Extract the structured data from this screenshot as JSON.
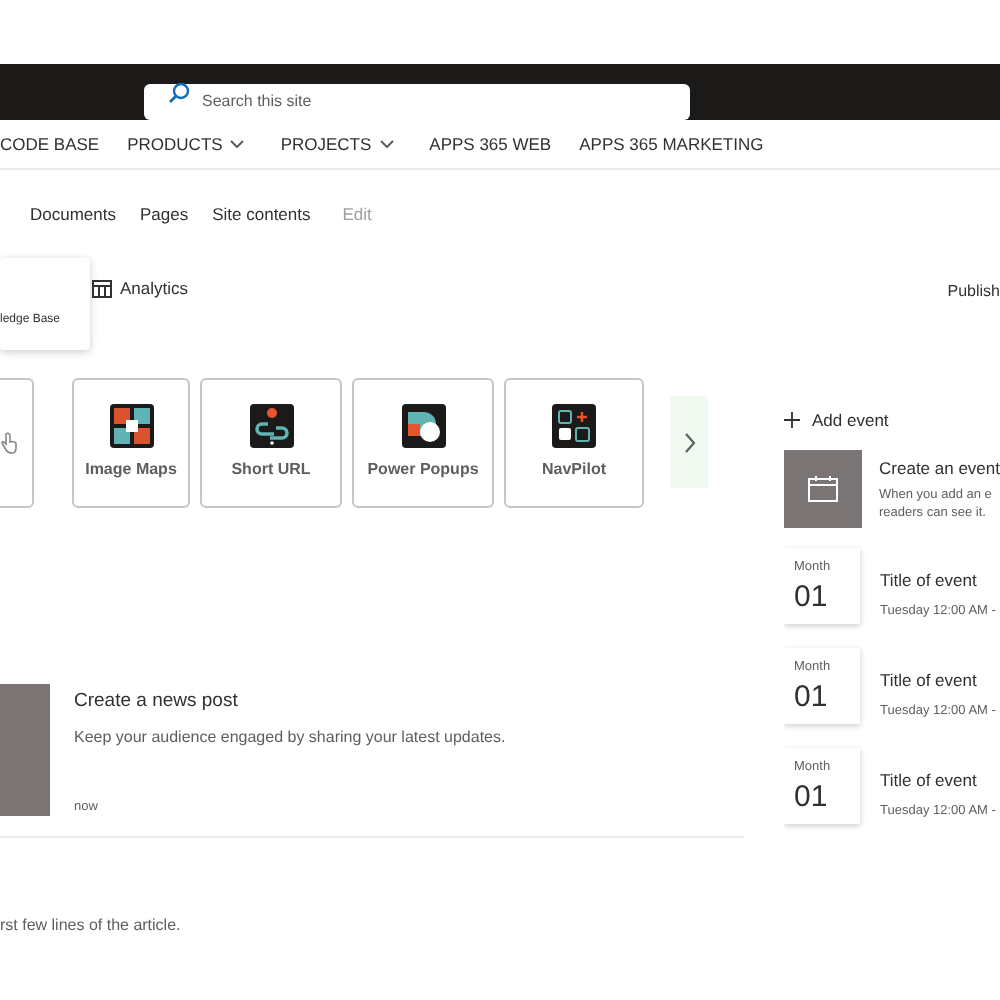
{
  "search": {
    "placeholder": "Search this site"
  },
  "nav": [
    {
      "label": "CODE BASE",
      "dropdown": false
    },
    {
      "label": "PRODUCTS",
      "dropdown": true
    },
    {
      "label": "PROJECTS",
      "dropdown": true
    },
    {
      "label": "APPS 365 WEB",
      "dropdown": false
    },
    {
      "label": "APPS 365 MARKETING",
      "dropdown": false
    }
  ],
  "subnav": [
    {
      "label": "Documents",
      "disabled": false
    },
    {
      "label": "Pages",
      "disabled": false
    },
    {
      "label": "Site contents",
      "disabled": false
    },
    {
      "label": "Edit",
      "disabled": true
    }
  ],
  "flyout": {
    "text": "ledge Base"
  },
  "toolbar": {
    "analytics": "Analytics",
    "publish": "Publish"
  },
  "apps": [
    {
      "label": "Image Maps",
      "kind": "image-maps"
    },
    {
      "label": "Short URL",
      "kind": "short-url"
    },
    {
      "label": "Power Popups",
      "kind": "power-popups"
    },
    {
      "label": "NavPilot",
      "kind": "navpilot"
    }
  ],
  "events": {
    "add": "Add event",
    "create_title": "Create an event",
    "create_lines": [
      "When you add an e",
      "readers can see it."
    ],
    "items": [
      {
        "month": "Month",
        "day": "01",
        "title": "Title of event",
        "time": "Tuesday 12:00 AM -"
      },
      {
        "month": "Month",
        "day": "01",
        "title": "Title of event",
        "time": "Tuesday 12:00 AM -"
      },
      {
        "month": "Month",
        "day": "01",
        "title": "Title of event",
        "time": "Tuesday 12:00 AM -"
      }
    ]
  },
  "news": {
    "title": "Create a news post",
    "description": "Keep your audience engaged by sharing your latest updates.",
    "time": "now"
  },
  "article_excerpt": "rst few lines of the article."
}
